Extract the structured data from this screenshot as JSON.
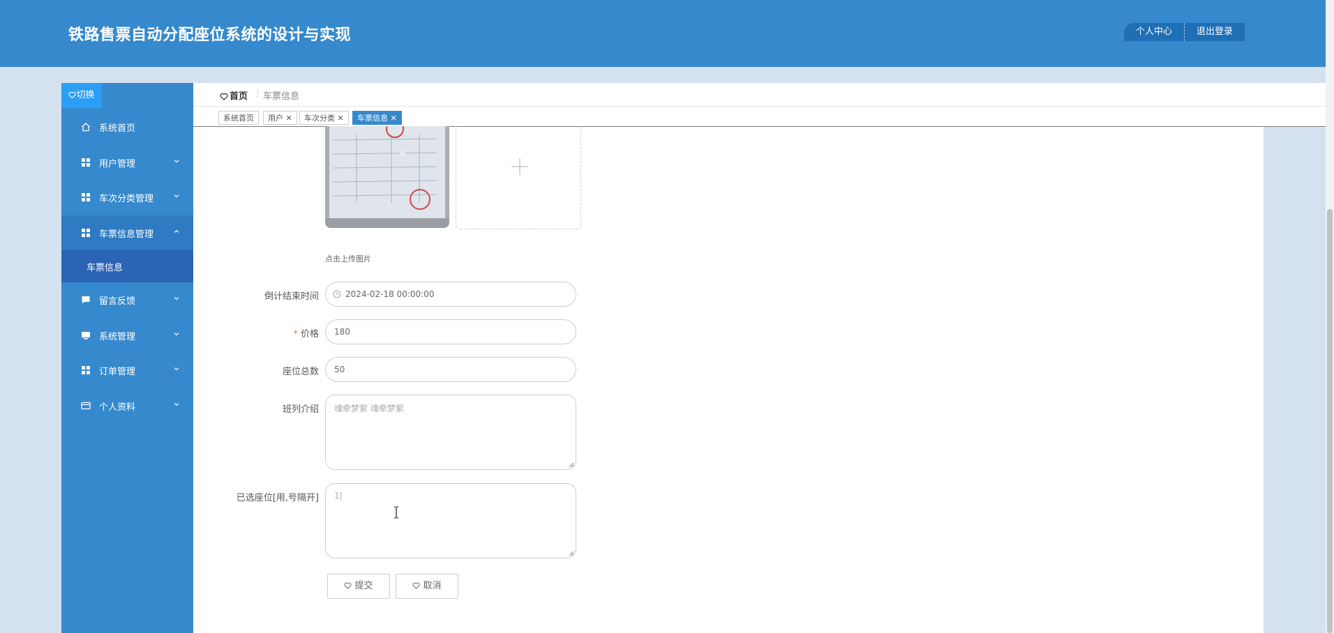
{
  "header": {
    "title": "铁路售票自动分配座位系统的设计与实现",
    "nav": [
      "个人中心",
      "退出登录"
    ]
  },
  "sidebar": {
    "toggle_label": "切换",
    "items": [
      {
        "label": "系统首页",
        "icon": "home-icon"
      },
      {
        "label": "用户管理",
        "icon": "grid-icon"
      },
      {
        "label": "车次分类管理",
        "icon": "grid-icon"
      },
      {
        "label": "车票信息管理",
        "icon": "grid-icon",
        "expanded": true
      },
      {
        "label": "留言反馈",
        "icon": "chat-icon"
      },
      {
        "label": "系统管理",
        "icon": "monitor-icon"
      },
      {
        "label": "订单管理",
        "icon": "grid-icon"
      },
      {
        "label": "个人资料",
        "icon": "card-icon"
      }
    ],
    "submenu": [
      "车票信息"
    ]
  },
  "breadcrumb": {
    "home": "首页",
    "current": "车票信息"
  },
  "tabs": [
    "系统首页",
    "用户",
    "车次分类",
    "车票信息"
  ],
  "upload": {
    "hint": "点击上传图片"
  },
  "form": {
    "end_time": {
      "label": "倒计结束时间",
      "value": "2024-02-18 00:00:00"
    },
    "price": {
      "label": "价格",
      "value": "180"
    },
    "total_seats": {
      "label": "座位总数",
      "value": "50"
    },
    "description": {
      "label": "班列介绍",
      "value": "魂牵梦萦 魂牵梦萦"
    },
    "selected_seats": {
      "label": "已选座位[用,号隔开]",
      "value": "1|"
    }
  },
  "buttons": {
    "submit": "提交",
    "cancel": "取消"
  },
  "colors": {
    "primary": "#3689cd",
    "accent": "#2b9ff6",
    "required": "#f56c6c"
  }
}
